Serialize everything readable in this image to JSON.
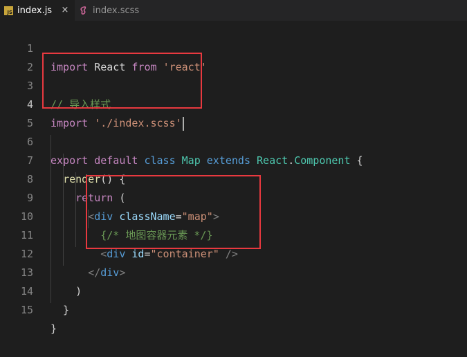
{
  "tabs": [
    {
      "label": "index.js",
      "icon": "js-file-icon",
      "active": true,
      "close": "×",
      "badge": "JS"
    },
    {
      "label": "index.scss",
      "icon": "sass-file-icon",
      "active": false
    }
  ],
  "editor": {
    "line_numbers": [
      "1",
      "2",
      "3",
      "4",
      "5",
      "6",
      "7",
      "8",
      "9",
      "10",
      "11",
      "12",
      "13",
      "14",
      "15"
    ],
    "lines": {
      "l1": {
        "a": "import",
        "b": " React ",
        "c": "from",
        "d": " ",
        "e": "'react'"
      },
      "l3": {
        "a": "// 导入样式"
      },
      "l4": {
        "a": "import",
        "b": " ",
        "c": "'./index.scss'"
      },
      "l6": {
        "a": "export",
        "b": " ",
        "c": "default",
        "d": " ",
        "e": "class",
        "f": " ",
        "g": "Map",
        "h": " ",
        "i": "extends",
        "j": " ",
        "k": "React",
        "l": ".",
        "m": "Component",
        "n": " {"
      },
      "l7": {
        "a": "  ",
        "b": "render",
        "c": "() {"
      },
      "l8": {
        "a": "    ",
        "b": "return",
        "c": " ("
      },
      "l9": {
        "a": "      ",
        "b": "<",
        "c": "div",
        "d": " ",
        "e": "className",
        "f": "=",
        "g": "\"map\"",
        "h": ">"
      },
      "l10": {
        "a": "        ",
        "b": "{/* 地图容器元素 */}"
      },
      "l11": {
        "a": "        ",
        "b": "<",
        "c": "div",
        "d": " ",
        "e": "id",
        "f": "=",
        "g": "\"container\"",
        "h": " />"
      },
      "l12": {
        "a": "      ",
        "b": "</",
        "c": "div",
        "d": ">"
      },
      "l13": {
        "a": "    )"
      },
      "l14": {
        "a": "  }"
      },
      "l15": {
        "a": "}"
      }
    },
    "current_line": "4"
  },
  "colors": {
    "highlight_box": "#e8393f",
    "background": "#1e1e1e"
  }
}
